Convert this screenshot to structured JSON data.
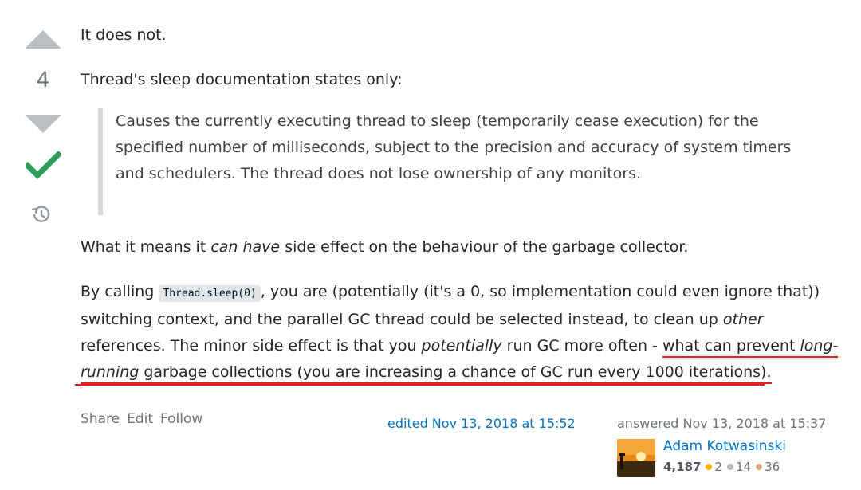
{
  "vote": {
    "score": "4"
  },
  "post": {
    "p1": "It does not.",
    "p2": "Thread's sleep documentation states only:",
    "quote": "Causes the currently executing thread to sleep (temporarily cease execution) for the specified number of milliseconds, subject to the precision and accuracy of system timers and schedulers. The thread does not lose ownership of any monitors.",
    "p3_a": "What it means it ",
    "p3_em": "can have",
    "p3_b": " side effect on the behaviour of the garbage collector.",
    "p4_a": "By calling ",
    "p4_code": "Thread.sleep(0)",
    "p4_b": ", you are (potentially (it's a 0, so implementation could even ignore that)) switching context, and the parallel GC thread could be selected instead, to clean up ",
    "p4_em1": "other",
    "p4_c": " references. The minor side effect is that you ",
    "p4_em2": "potentially",
    "p4_d": " run GC more often - ",
    "p4_e": "what can prevent ",
    "p4_em3": "long-running",
    "p4_f": " garbage collections (you are increasing a chance of GC run every 1000 iterations)."
  },
  "footer": {
    "share": "Share",
    "edit": "Edit",
    "follow": "Follow",
    "edited": "edited Nov 13, 2018 at 15:52"
  },
  "user": {
    "answered": "answered Nov 13, 2018 at 15:37",
    "name": "Adam Kotwasinski",
    "reputation": "4,187",
    "gold": "2",
    "silver": "14",
    "bronze": "36"
  },
  "colors": {
    "accent": "#0074cc",
    "accepted": "#2f9e5a",
    "annotation": "#e02020",
    "gold": "#f1b600",
    "silver": "#b4b8bc",
    "bronze": "#d1a684"
  }
}
